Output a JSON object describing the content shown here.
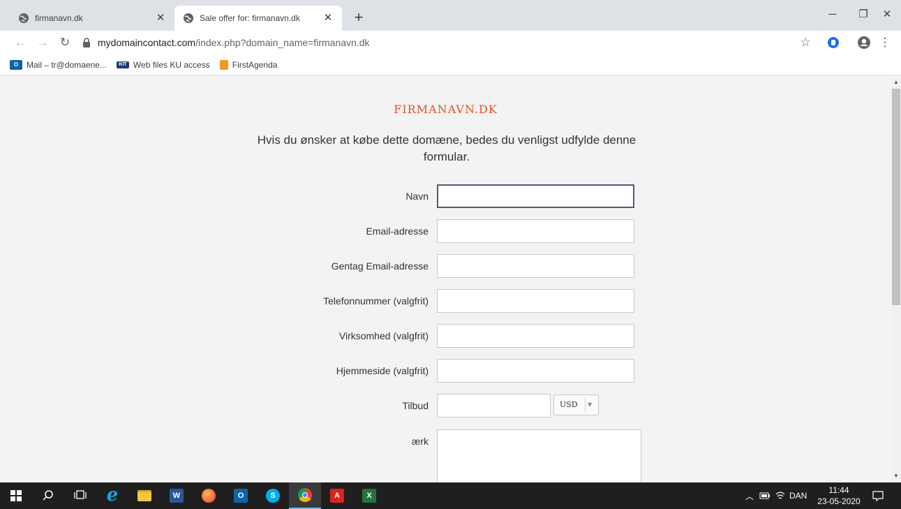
{
  "browser": {
    "tabs": [
      {
        "title": "firmanavn.dk",
        "active": false
      },
      {
        "title": "Sale offer for: firmanavn.dk",
        "active": true
      }
    ],
    "new_tab_label": "+",
    "url": {
      "host": "mydomaincontact.com",
      "path": "/index.php?domain_name=firmanavn.dk"
    },
    "bookmarks": [
      {
        "label": "Mail – tr@domaene...",
        "icon": "outlook-icon"
      },
      {
        "label": "Web files KU access",
        "icon": "kit-icon"
      },
      {
        "label": "FirstAgenda",
        "icon": "firstagenda-icon"
      }
    ]
  },
  "page": {
    "site_title": "FIRMANAVN.DK",
    "intro": "Hvis du ønsker at købe dette domæne, bedes du venligst udfylde denne formular.",
    "fields": {
      "name": {
        "label": "Navn",
        "value": ""
      },
      "email": {
        "label": "Email-adresse",
        "value": ""
      },
      "email_repeat": {
        "label": "Gentag Email-adresse",
        "value": ""
      },
      "phone": {
        "label": "Telefonnummer (valgfrit)",
        "value": ""
      },
      "company": {
        "label": "Virksomhed (valgfrit)",
        "value": ""
      },
      "website": {
        "label": "Hjemmeside (valgfrit)",
        "value": ""
      },
      "offer": {
        "label": "Tilbud",
        "value": "",
        "currency": "USD"
      },
      "remark": {
        "label": "ærk",
        "value": ""
      }
    }
  },
  "taskbar": {
    "apps": [
      "start",
      "search",
      "task-view",
      "internet-explorer",
      "file-explorer",
      "word",
      "firefox",
      "outlook",
      "skype",
      "chrome",
      "acrobat",
      "excel"
    ],
    "active_app": "chrome",
    "language": "DAN",
    "time": "11:44",
    "date": "23-05-2020"
  },
  "colors": {
    "accent": "#e8502f",
    "taskbar": "#1f1f1f",
    "focus_border": "#4a5d73"
  }
}
